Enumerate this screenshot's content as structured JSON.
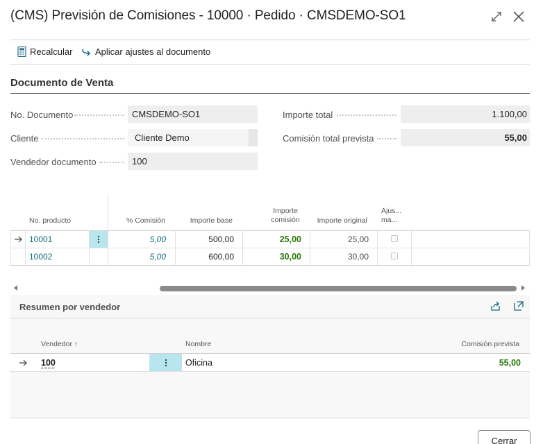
{
  "window": {
    "title": "(CMS) Previsión de Comisiones - 10000 · Pedido · CMSDEMO-SO1"
  },
  "actions": {
    "recalc": "Recalcular",
    "apply": "Aplicar ajustes al documento"
  },
  "section": {
    "title": "Documento de Venta"
  },
  "fields": {
    "doc_no_label": "No. Documento",
    "doc_no_value": "CMSDEMO-SO1",
    "customer_label": "Cliente",
    "customer_value": "Cliente Demo",
    "salesperson_label": "Vendedor documento",
    "salesperson_value": "100",
    "total_label": "Importe total",
    "total_value": "1.100,00",
    "commission_label": "Comisión total prevista",
    "commission_value": "55,00"
  },
  "lines": {
    "headers": {
      "product": "No. producto",
      "pct": "% Comisión",
      "base": "Importe base",
      "comm_1": "Importe",
      "comm_2": "comisión",
      "orig": "Importe original",
      "adj_1": "Ajus...",
      "adj_2": "ma..."
    },
    "rows": [
      {
        "product": "10001",
        "pct": "5,00",
        "base": "500,00",
        "comm": "25,00",
        "orig": "25,00"
      },
      {
        "product": "10002",
        "pct": "5,00",
        "base": "600,00",
        "comm": "30,00",
        "orig": "30,00"
      }
    ]
  },
  "summary": {
    "title": "Resumen por vendedor",
    "headers": {
      "salesperson": "Vendedor",
      "name": "Nombre",
      "commission": "Comisión prevista"
    },
    "rows": [
      {
        "salesperson": "100",
        "name": "Oficina",
        "commission": "55,00"
      }
    ]
  },
  "footer": {
    "close": "Cerrar"
  },
  "colors": {
    "accent": "#0e6c7e",
    "positive": "#2b7a0b",
    "selected_cell": "#b9e6ee"
  }
}
